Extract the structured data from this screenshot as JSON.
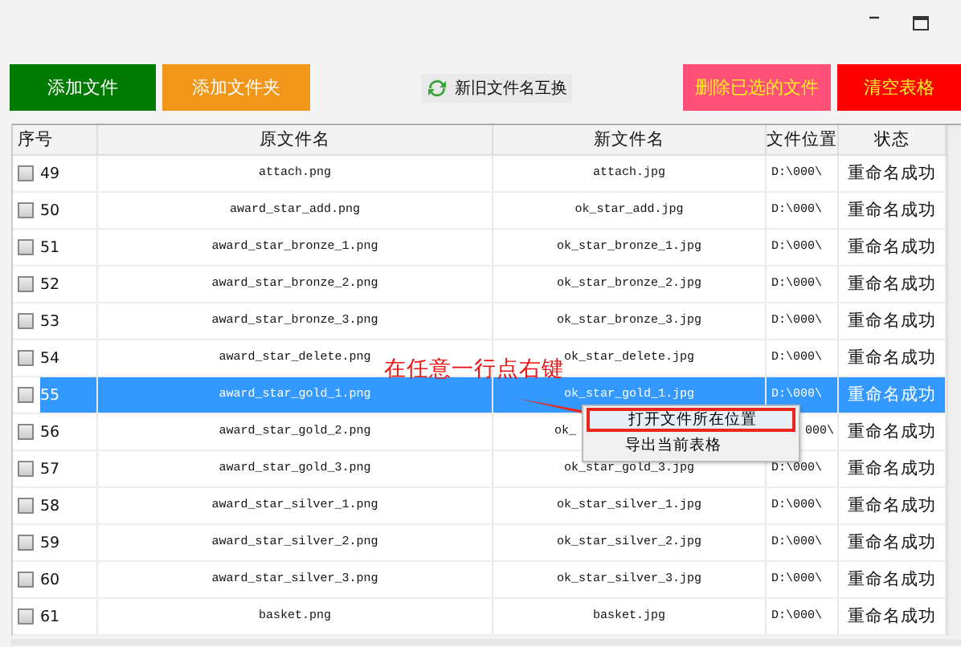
{
  "buttons": [
    {
      "kind": "add",
      "label": "添加文件"
    },
    {
      "kind": "folder",
      "label": "添加文件夹"
    },
    {
      "kind": "swap",
      "label": "新旧文件名互换"
    },
    {
      "kind": "delete",
      "label": "删除已选的文件"
    },
    {
      "kind": "clear",
      "label": "清空表格"
    }
  ],
  "table": {
    "columns": [
      "序号",
      "原文件名",
      "新文件名",
      "文件位置",
      "状态"
    ],
    "rows": [
      {
        "checked": false,
        "selected": false,
        "no": "49",
        "old_name": "attach.png",
        "new_name": "attach.jpg",
        "location": "D:\\000\\",
        "status": "重命名成功"
      },
      {
        "checked": false,
        "selected": false,
        "no": "50",
        "old_name": "award_star_add.png",
        "new_name": "ok_star_add.jpg",
        "location": "D:\\000\\",
        "status": "重命名成功"
      },
      {
        "checked": false,
        "selected": false,
        "no": "51",
        "old_name": "award_star_bronze_1.png",
        "new_name": "ok_star_bronze_1.jpg",
        "location": "D:\\000\\",
        "status": "重命名成功"
      },
      {
        "checked": false,
        "selected": false,
        "no": "52",
        "old_name": "award_star_bronze_2.png",
        "new_name": "ok_star_bronze_2.jpg",
        "location": "D:\\000\\",
        "status": "重命名成功"
      },
      {
        "checked": false,
        "selected": false,
        "no": "53",
        "old_name": "award_star_bronze_3.png",
        "new_name": "ok_star_bronze_3.jpg",
        "location": "D:\\000\\",
        "status": "重命名成功"
      },
      {
        "checked": false,
        "selected": false,
        "no": "54",
        "old_name": "award_star_delete.png",
        "new_name": "ok_star_delete.jpg",
        "location": "D:\\000\\",
        "status": "重命名成功"
      },
      {
        "checked": false,
        "selected": true,
        "no": "55",
        "old_name": "award_star_gold_1.png",
        "new_name": "ok_star_gold_1.jpg",
        "location": "D:\\000\\",
        "status": "重命名成功"
      },
      {
        "checked": false,
        "selected": false,
        "covered": true,
        "no": "56",
        "old_name": "award_star_gold_2.png",
        "new_name": "ok_",
        "location": "000\\",
        "status": "重命名成功"
      },
      {
        "checked": false,
        "selected": false,
        "no": "57",
        "old_name": "award_star_gold_3.png",
        "new_name": "ok_star_gold_3.jpg",
        "location": "D:\\000\\",
        "status": "重命名成功"
      },
      {
        "checked": false,
        "selected": false,
        "no": "58",
        "old_name": "award_star_silver_1.png",
        "new_name": "ok_star_silver_1.jpg",
        "location": "D:\\000\\",
        "status": "重命名成功"
      },
      {
        "checked": false,
        "selected": false,
        "no": "59",
        "old_name": "award_star_silver_2.png",
        "new_name": "ok_star_silver_2.jpg",
        "location": "D:\\000\\",
        "status": "重命名成功"
      },
      {
        "checked": false,
        "selected": false,
        "no": "60",
        "old_name": "award_star_silver_3.png",
        "new_name": "ok_star_silver_3.jpg",
        "location": "D:\\000\\",
        "status": "重命名成功"
      },
      {
        "checked": false,
        "selected": false,
        "no": "61",
        "old_name": "basket.png",
        "new_name": "basket.jpg",
        "location": "D:\\000\\",
        "status": "重命名成功"
      }
    ]
  },
  "annotation": "在任意一行点右键",
  "context_menu": [
    {
      "label": "打开文件所在位置",
      "selected": true
    },
    {
      "label": "导出当前表格",
      "selected": false
    }
  ]
}
